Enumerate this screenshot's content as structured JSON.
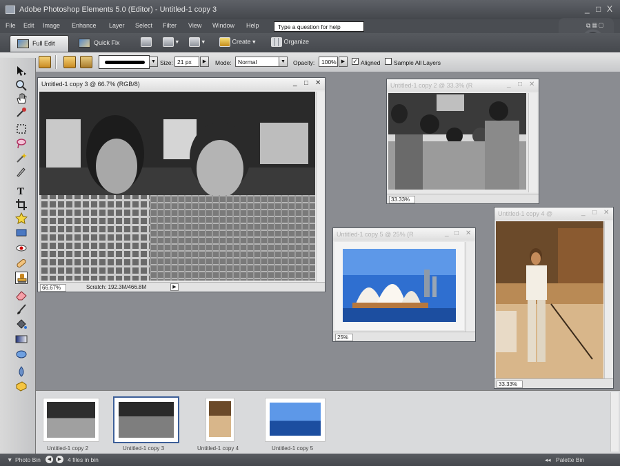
{
  "window": {
    "title": "Adobe Photoshop Elements 5.0 (Editor) - Untitled-1 copy 3",
    "controls": [
      "_",
      "□",
      "X"
    ]
  },
  "menu": {
    "items": [
      "File",
      "Edit",
      "Image",
      "Enhance",
      "Layer",
      "Select",
      "Filter",
      "View",
      "Window",
      "Help"
    ],
    "help_placeholder": "Type a question for help"
  },
  "mode_bar": {
    "full_edit": "Full Edit",
    "quick_fix": "Quick Fix",
    "create": "Create ▾",
    "organize": "Organize"
  },
  "options_bar": {
    "size_label": "Size:",
    "size_value": "21 px",
    "mode_label": "Mode:",
    "mode_value": "Normal",
    "opacity_label": "Opacity:",
    "opacity_value": "100%",
    "aligned_label": "Aligned",
    "aligned_checked": true,
    "sample_all_label": "Sample All Layers",
    "sample_all_checked": false
  },
  "tools": [
    "move-tool",
    "zoom-tool",
    "hand-tool",
    "eyedropper-tool",
    "marquee-tool",
    "lasso-tool",
    "magic-wand-tool",
    "selection-brush-tool",
    "type-tool",
    "crop-tool",
    "cookie-cutter-tool",
    "straighten-tool",
    "red-eye-tool",
    "healing-brush-tool",
    "clone-stamp-tool",
    "eraser-tool",
    "brush-tool",
    "paint-bucket-tool",
    "gradient-tool",
    "shape-tool",
    "blur-tool",
    "sponge-tool"
  ],
  "documents": {
    "main": {
      "title": "Untitled-1 copy 3 @ 66.7% (RGB/8)",
      "zoom": "66.67%",
      "scratch": "Scratch: 192.3M/466.8M"
    },
    "copy2": {
      "title": "Untitled-1 copy 2 @ 33.3% (R",
      "zoom": "33.33%"
    },
    "copy5": {
      "title": "Untitled-1 copy 5 @ 25% (R",
      "zoom": "25%"
    },
    "copy4": {
      "title": "Untitled-1 copy 4 @",
      "zoom": "33.33%"
    }
  },
  "photo_bin": {
    "items": [
      {
        "label": "Untitled-1 copy 2"
      },
      {
        "label": "Untitled-1 copy 3"
      },
      {
        "label": "Untitled-1 copy 4"
      },
      {
        "label": "Untitled-1 copy 5"
      }
    ],
    "selected_index": 1
  },
  "bottom_bar": {
    "photo_bin_label": "Photo Bin",
    "files_count": "4 files in bin",
    "palette_bin_label": "Palette Bin"
  },
  "colors": {
    "chrome_dark": "#4a4d52",
    "workspace": "#8a8c91",
    "selected_thumb_border": "#3c5e98",
    "sky_blue": "#2f6fd0",
    "sepia": "#b98a55"
  }
}
